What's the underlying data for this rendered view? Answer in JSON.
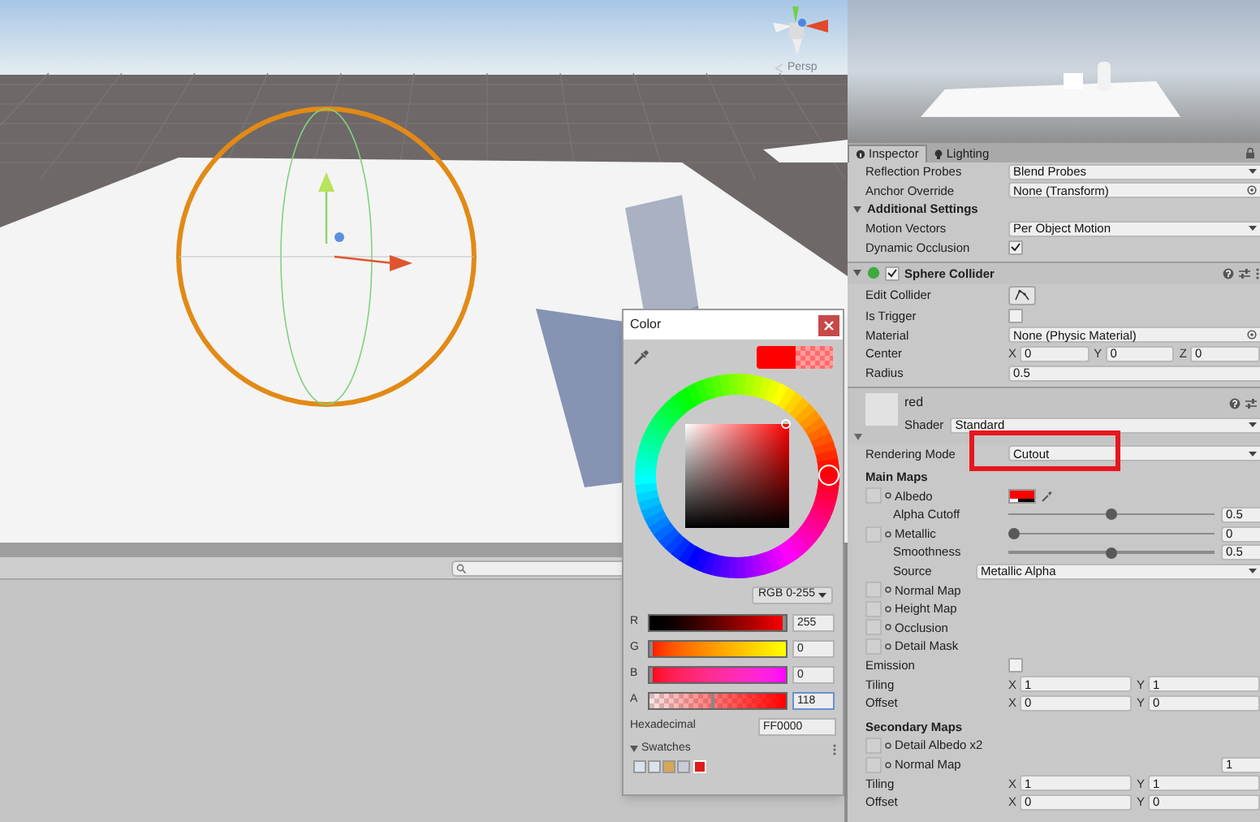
{
  "scene": {
    "view_mode": "Persp"
  },
  "tabs": [
    {
      "label": "Inspector",
      "selected": true
    },
    {
      "label": "Lighting",
      "selected": false
    }
  ],
  "inspector": {
    "rows": [
      {
        "kind": "dropdown",
        "label": "Reflection Probes",
        "value": "Blend Probes"
      },
      {
        "kind": "object",
        "label": "Anchor Override",
        "value": "None (Transform)"
      },
      {
        "kind": "foldout",
        "label": "Additional Settings",
        "expanded": true
      },
      {
        "kind": "dropdown",
        "label": "Motion Vectors",
        "value": "Per Object Motion"
      },
      {
        "kind": "checkbox",
        "label": "Dynamic Occlusion",
        "checked": true
      },
      {
        "kind": "component",
        "title": "Sphere Collider",
        "enabled": true,
        "expanded": true
      },
      {
        "kind": "button",
        "label": "Edit Collider"
      },
      {
        "kind": "checkbox",
        "label": "Is Trigger",
        "checked": false
      },
      {
        "kind": "object",
        "label": "Material",
        "value": "None (Physic Material)"
      },
      {
        "kind": "vector",
        "label": "Center",
        "components": [
          {
            "axis": "X",
            "value": "0"
          },
          {
            "axis": "Y",
            "value": "0"
          },
          {
            "axis": "Z",
            "value": "0"
          }
        ]
      },
      {
        "kind": "number",
        "label": "Radius",
        "value": "0.5"
      },
      {
        "kind": "material",
        "name": "red",
        "shader_label": "Shader",
        "shader": "Standard"
      },
      {
        "kind": "dropdown",
        "label": "Rendering Mode",
        "value": "Cutout",
        "highlighted": true
      },
      {
        "kind": "section",
        "label": "Main Maps"
      },
      {
        "kind": "texture",
        "label": "Albedo",
        "color": "#ff0000",
        "children": [
          {
            "kind": "slider",
            "label": "Alpha Cutoff",
            "level": 0.5,
            "value": "0.5"
          }
        ]
      },
      {
        "kind": "texture",
        "label": "Metallic",
        "children": [
          {
            "kind": "slider",
            "label": "Smoothness",
            "level": 0.5,
            "value": "0.5"
          },
          {
            "kind": "dropdown",
            "label": "Source",
            "value": "Metallic Alpha"
          }
        ],
        "slider": {
          "level": 0,
          "value": "0"
        }
      },
      {
        "kind": "texture",
        "label": "Normal Map"
      },
      {
        "kind": "texture",
        "label": "Height Map"
      },
      {
        "kind": "texture",
        "label": "Occlusion"
      },
      {
        "kind": "texture",
        "label": "Detail Mask"
      },
      {
        "kind": "checkbox",
        "label": "Emission",
        "checked": false
      },
      {
        "kind": "vector",
        "label": "Tiling",
        "components": [
          {
            "axis": "X",
            "value": "1"
          },
          {
            "axis": "Y",
            "value": "1"
          }
        ]
      },
      {
        "kind": "vector",
        "label": "Offset",
        "components": [
          {
            "axis": "X",
            "value": "0"
          },
          {
            "axis": "Y",
            "value": "0"
          }
        ]
      },
      {
        "kind": "section",
        "label": "Secondary Maps"
      },
      {
        "kind": "texture",
        "label": "Detail Albedo x2"
      },
      {
        "kind": "texture",
        "label": "Normal Map",
        "value": "1"
      },
      {
        "kind": "vector",
        "label": "Tiling",
        "components": [
          {
            "axis": "X",
            "value": "1"
          },
          {
            "axis": "Y",
            "value": "1"
          }
        ]
      },
      {
        "kind": "vector",
        "label": "Offset",
        "components": [
          {
            "axis": "X",
            "value": "0"
          },
          {
            "axis": "Y",
            "value": "0"
          }
        ]
      }
    ]
  },
  "color_picker": {
    "title": "Color",
    "mode": "RGB 0-255",
    "channels": [
      {
        "label": "R",
        "value": "255",
        "level": 1
      },
      {
        "label": "G",
        "value": "0",
        "level": 0
      },
      {
        "label": "B",
        "value": "0",
        "level": 0
      },
      {
        "label": "A",
        "value": "118",
        "level": 0.46
      }
    ],
    "hex_label": "Hexadecimal",
    "hex": "FF0000",
    "swatches_label": "Swatches",
    "swatches": [
      {
        "color": "#d8e3ec"
      },
      {
        "color": "#d8e3ec"
      },
      {
        "color": "#d8a657"
      },
      {
        "color": "#c8ccd8"
      },
      {
        "color": "#e01b1b"
      }
    ]
  }
}
